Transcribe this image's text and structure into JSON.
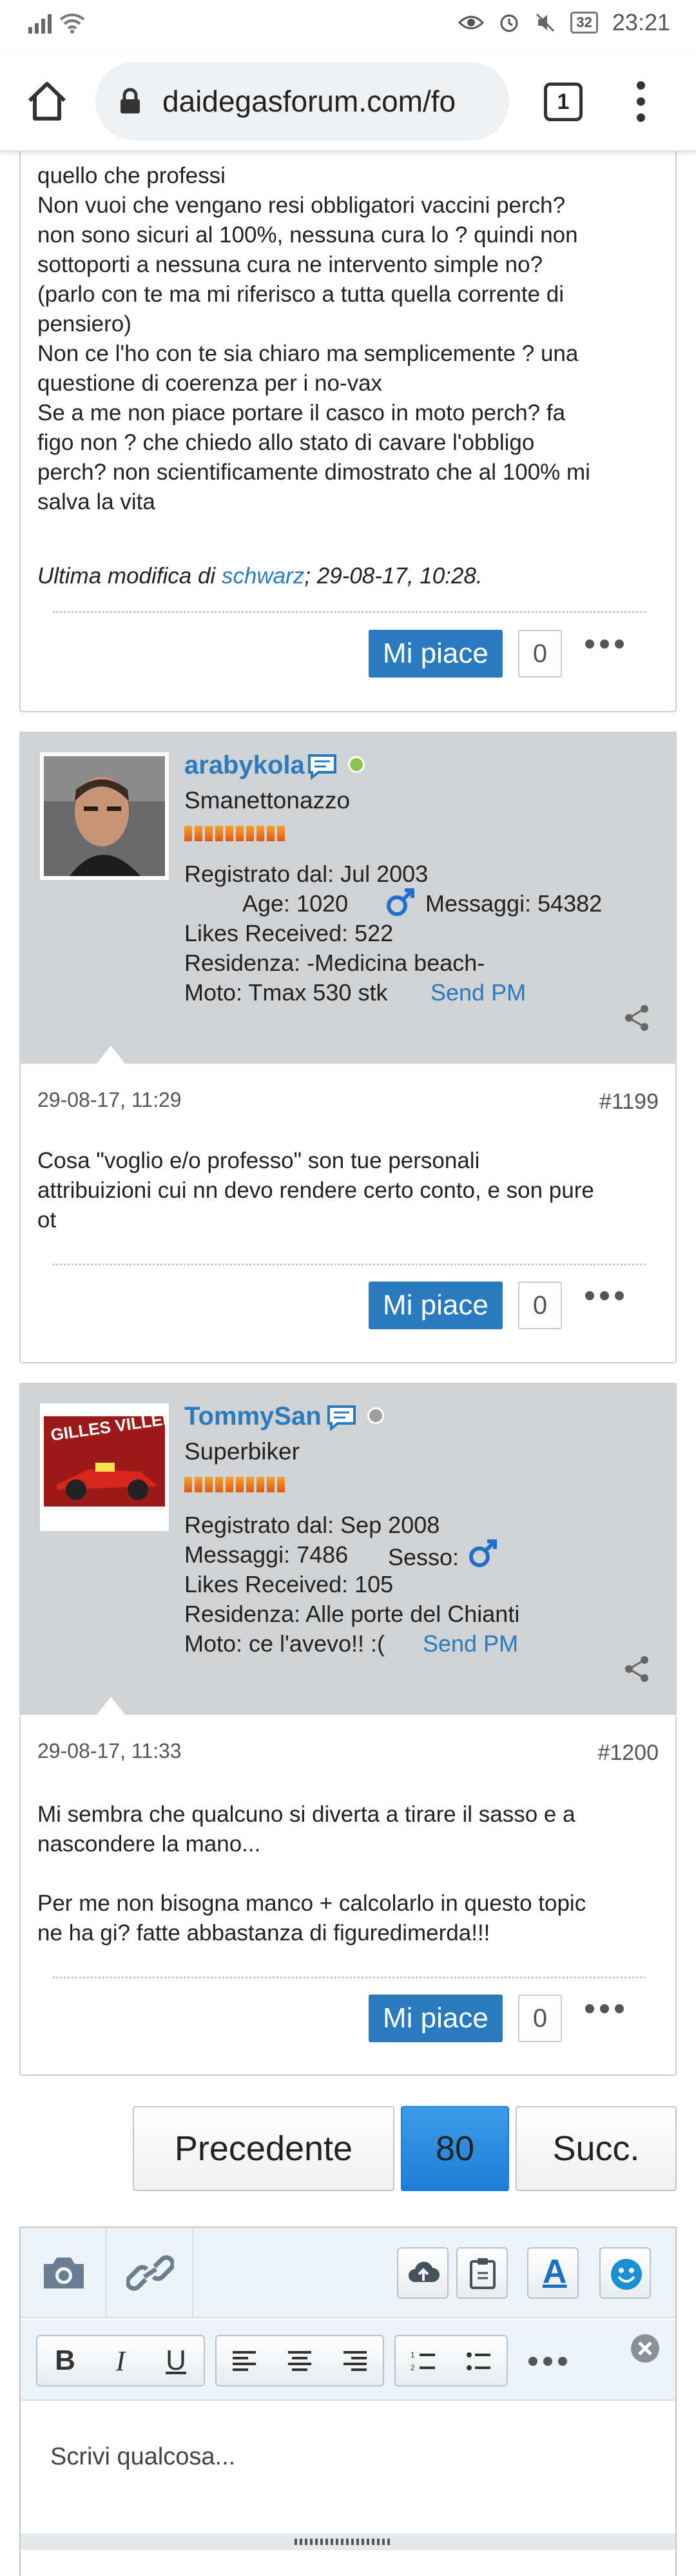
{
  "status_bar": {
    "time": "23:21",
    "battery": "32"
  },
  "browser": {
    "url": "daidegasforum.com/fo",
    "tab_count": "1"
  },
  "post_top": {
    "lines": [
      "quello che professi",
      "Non vuoi che vengano resi obbligatori vaccini perch?",
      "non sono sicuri al 100%, nessuna cura lo ? quindi non",
      "sottoporti a nessuna cura ne intervento simple no?",
      "(parlo con te ma mi riferisco a tutta quella corrente di",
      "pensiero)",
      "Non ce l'ho con te sia chiaro ma semplicemente ? una",
      "questione di coerenza per i no-vax",
      "Se a me non piace portare il casco in moto perch? fa",
      "figo non ? che chiedo allo stato di cavare l'obbligo",
      "perch? non scientificamente dimostrato che al 100% mi",
      "salva la vita"
    ],
    "edited_prefix": "Ultima modifica di",
    "edited_user": "schwarz",
    "edited_suffix": "; 29-08-17, 10:28.",
    "like_label": "Mi piace",
    "like_count": "0"
  },
  "user1": {
    "name": "arabykola",
    "title": "Smanettonazzo",
    "registered": "Registrato dal: Jul 2003",
    "age": "Age: 1020",
    "messages": "Messaggi: 54382",
    "likes": "Likes Received: 522",
    "residence": "Residenza: -Medicina beach-",
    "moto": "Moto: Tmax 530 stk",
    "send_pm": "Send PM",
    "online_color": "#8bc34a"
  },
  "post1199": {
    "date": "29-08-17, 11:29",
    "number": "#1199",
    "lines": [
      "Cosa \"voglio e/o professo\" son tue personali",
      "attribuizioni cui nn devo rendere certo conto, e son pure",
      "ot"
    ],
    "like_label": "Mi piace",
    "like_count": "0"
  },
  "user2": {
    "name": "TommySan",
    "title": "Superbiker",
    "avatar_text": "GILLES VILLENEUVE",
    "registered": "Registrato dal: Sep 2008",
    "messages": "Messaggi: 7486",
    "gender": "Sesso:",
    "likes": "Likes Received: 105",
    "residence": "Residenza: Alle porte del Chianti",
    "moto": "Moto: ce l'avevo!! :(",
    "send_pm": "Send PM",
    "online_color": "#9e9e9e"
  },
  "post1200": {
    "date": "29-08-17, 11:33",
    "number": "#1200",
    "lines": [
      "Mi sembra che qualcuno si diverta a tirare il sasso e a",
      "nascondere la mano...",
      "",
      "Per me non bisogna manco + calcolarlo in questo topic",
      "ne ha gi? fatte abbastanza di figuredimerda!!!"
    ],
    "like_label": "Mi piace",
    "like_count": "0"
  },
  "pagination": {
    "prev": "Precedente",
    "current": "80",
    "next": "Succ."
  },
  "editor": {
    "placeholder": "Scrivi qualcosa...",
    "bold": "B",
    "italic": "I",
    "underline": "U",
    "text_color": "A"
  },
  "colors": {
    "link": "#2a7abf",
    "like_button": "#2a7abf",
    "user_panel": "#d1d2d4",
    "current_page": "#1b7fd6"
  }
}
